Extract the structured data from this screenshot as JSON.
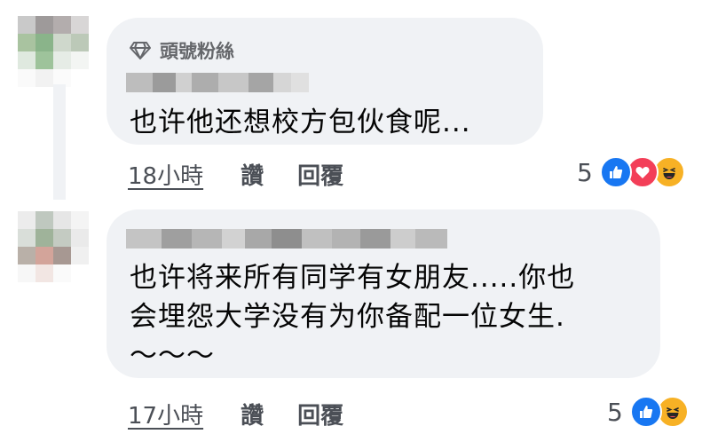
{
  "comments": [
    {
      "badge": "頭號粉絲",
      "text": "也许他还想校方包伙食呢...",
      "time": "18小時",
      "like_label": "讚",
      "reply_label": "回覆",
      "reaction_count": "5",
      "reaction_icons": [
        "like-icon",
        "love-icon",
        "haha-icon"
      ]
    },
    {
      "text": "也许将来所有同学有女朋友.....你也\n会埋怨大学没有为你备配一位女生.\n～～～",
      "time": "17小時",
      "like_label": "讚",
      "reply_label": "回覆",
      "reaction_count": "5",
      "reaction_icons": [
        "like-icon",
        "haha-icon"
      ]
    }
  ],
  "colors": {
    "bubble": "#f0f2f5",
    "like_reaction": "#1877f2",
    "love_reaction": "#f33e58",
    "haha_reaction": "#f7b125",
    "meta_text": "#65676b"
  }
}
